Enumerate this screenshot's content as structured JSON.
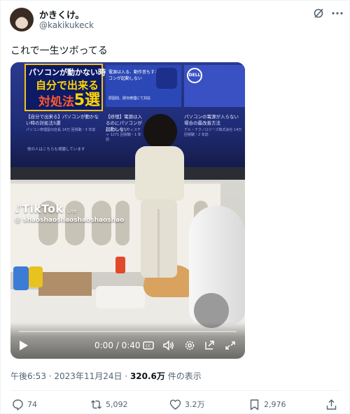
{
  "author": {
    "display_name": "かきくけ。",
    "handle": "@kakikukeck"
  },
  "tweet": {
    "text": "これで一生ツボってる"
  },
  "video": {
    "watermark_logo": "TikTok",
    "watermark_sub": "Lite",
    "watermark_user": "@ shaoshaoshaoshaoshaoshao",
    "time": "0:00 / 0:40",
    "progress": 0.0,
    "screen": {
      "thumb1": [
        "パソコンが動かない時",
        "自分で出来る",
        "対処法",
        "5選"
      ],
      "thumb2": "電源は入る、動作音もするでもパソコンが起動しない",
      "thumb2_sub": "原因別、即日修理にて対応",
      "dell": "DELL",
      "cap1": "【自分で出来る】パソコンが動かない時の対処法5選",
      "cap1_sub": "パソコン修理屋の店長 14万 回視聴・3 年前",
      "cap2": "【修理】電源は入るのにパソコンが起動しない",
      "cap2_sub": "パソコンサーウィスチャ 1271 回視聴・1 年前",
      "cap3": "パソコンの電源が入らない場合の最改善方法",
      "cap3_sub": "デル・テクノロジーズ株式会社 14万 回視聴・2 年前",
      "more": "他の人はこちらも視聴しています"
    }
  },
  "meta": {
    "time": "午後6:53",
    "sep": " · ",
    "date": "2023年11月24日",
    "views": "320.6万",
    "views_suffix": " 件の表示"
  },
  "actions": {
    "replies": "74",
    "reposts": "5,092",
    "likes": "3.2万",
    "bookmarks": "2,976"
  },
  "colors": {
    "text": "#0f1419",
    "muted": "#536471",
    "divider": "#eff3f4"
  }
}
